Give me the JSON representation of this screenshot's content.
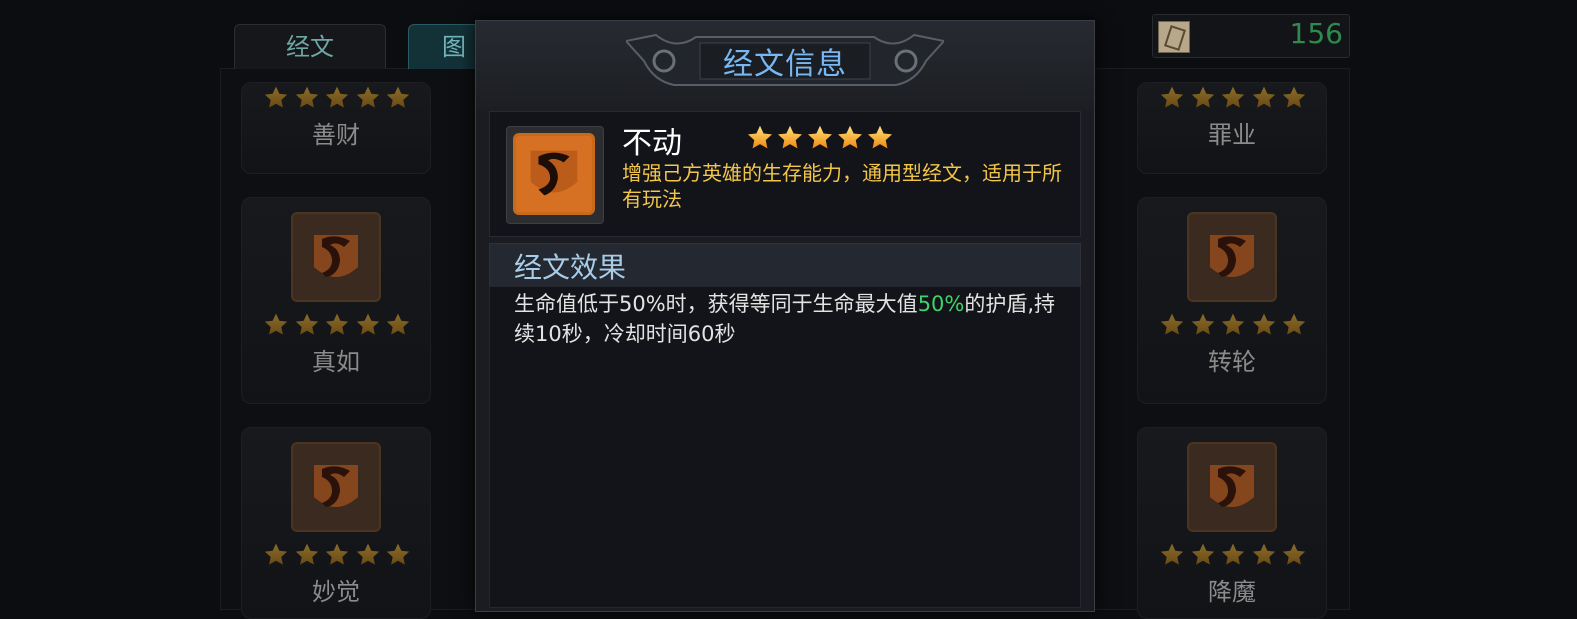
{
  "tabs": [
    {
      "label": "经文"
    },
    {
      "label": "图"
    }
  ],
  "currency": {
    "icon": "scroll-icon",
    "value": "156"
  },
  "cards_left": [
    {
      "name": "善财",
      "stars": 5,
      "icon": "rune-icon"
    },
    {
      "name": "真如",
      "stars": 5,
      "icon": "rune-icon"
    },
    {
      "name": "妙觉",
      "stars": 5,
      "icon": "rune-icon"
    }
  ],
  "cards_right": [
    {
      "name": "罪业",
      "stars": 5,
      "icon": "rune-icon"
    },
    {
      "name": "转轮",
      "stars": 5,
      "icon": "rune-icon"
    },
    {
      "name": "降魔",
      "stars": 5,
      "icon": "rune-icon"
    }
  ],
  "modal": {
    "title": "经文信息",
    "item": {
      "name": "不动",
      "stars": 5,
      "icon": "rune-icon",
      "description": "增强己方英雄的生存能力，通用型经文，适用于所有玩法"
    },
    "effect": {
      "title": "经文效果",
      "text_before": "生命值低于50%时，获得等同于生命最大值",
      "highlight": "50%",
      "text_after": "的护盾,持续10秒，冷却时间60秒"
    }
  },
  "colors": {
    "accent_blue": "#79b7f2",
    "description_gold": "#f2c64a",
    "highlight_green": "#3fd26a",
    "currency_green": "#2e8a4d"
  }
}
